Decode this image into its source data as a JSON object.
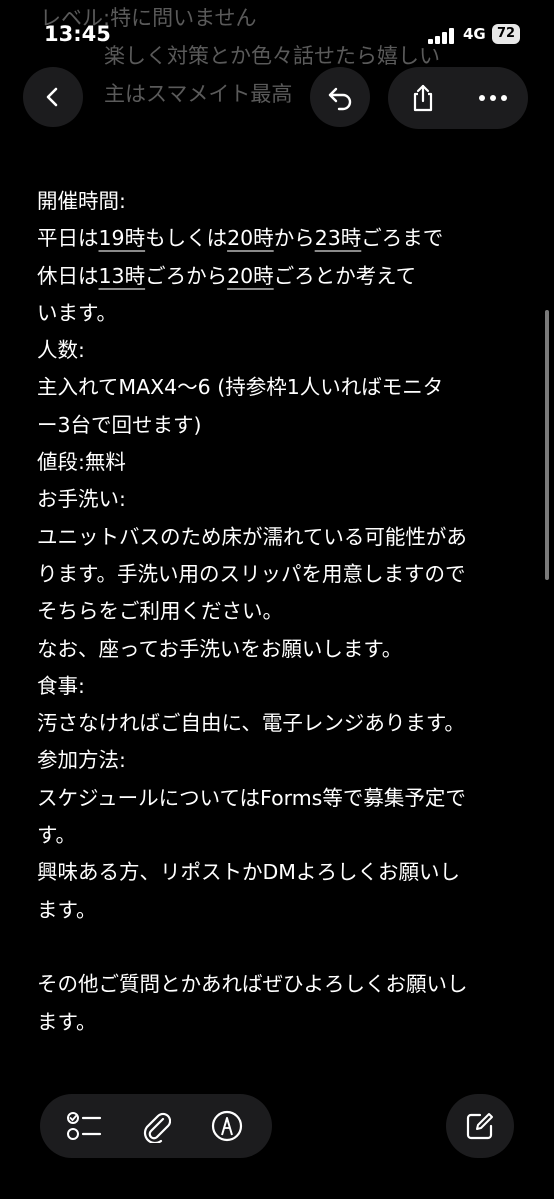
{
  "faded_background_lines": [
    "レベル:特に問いません",
    "楽しく対策とか色々話せたら嬉しい",
    "主はスマメイト最高"
  ],
  "status_bar": {
    "time": "13:45",
    "network": "4G",
    "battery": "72"
  },
  "nav": {
    "back_icon": "chevron-left-icon",
    "undo_icon": "undo-icon",
    "share_icon": "share-icon",
    "more_icon": "ellipsis-icon"
  },
  "note": {
    "lines": [
      [
        {
          "t": "開催時間:"
        }
      ],
      [
        {
          "t": "平日は"
        },
        {
          "t": "19時",
          "u": true
        },
        {
          "t": "もしくは"
        },
        {
          "t": "20時",
          "u": true
        },
        {
          "t": "から"
        },
        {
          "t": "23時",
          "u": true
        },
        {
          "t": "ごろまで"
        }
      ],
      [
        {
          "t": "休日は"
        },
        {
          "t": "13時",
          "u": true
        },
        {
          "t": "ごろから"
        },
        {
          "t": "20時",
          "u": true
        },
        {
          "t": "ごろとか考えて"
        }
      ],
      [
        {
          "t": "います。"
        }
      ],
      [
        {
          "t": "人数:"
        }
      ],
      [
        {
          "t": "主入れてMAX4～6 (持参枠1人いればモニタ"
        }
      ],
      [
        {
          "t": "ー3台で回せます)"
        }
      ],
      [
        {
          "t": "値段:無料"
        }
      ],
      [
        {
          "t": "お手洗い:"
        }
      ],
      [
        {
          "t": "ユニットバスのため床が濡れている可能性があ"
        }
      ],
      [
        {
          "t": "ります。手洗い用のスリッパを用意しますので"
        }
      ],
      [
        {
          "t": "そちらをご利用ください。"
        }
      ],
      [
        {
          "t": "なお、座ってお手洗いをお願いします。"
        }
      ],
      [
        {
          "t": "食事:"
        }
      ],
      [
        {
          "t": "汚さなければご自由に、電子レンジあります。"
        }
      ],
      [
        {
          "t": "参加方法:"
        }
      ],
      [
        {
          "t": "スケジュールについてはForms等で募集予定で"
        }
      ],
      [
        {
          "t": "す。"
        }
      ],
      [
        {
          "t": "興味ある方、リポストかDMよろしくお願いし"
        }
      ],
      [
        {
          "t": "ます。"
        }
      ],
      [
        {
          "t": ""
        }
      ],
      [
        {
          "t": "その他ご質問とかあればぜひよろしくお願いし"
        }
      ],
      [
        {
          "t": "ます。"
        }
      ]
    ]
  },
  "toolbar": {
    "checklist_icon": "checklist-icon",
    "attachment_icon": "paperclip-icon",
    "markup_icon": "pen-markup-icon",
    "compose_icon": "compose-icon"
  },
  "colors": {
    "background": "#000000",
    "button_bg": "#1c1c1e",
    "text": "#ffffff"
  }
}
